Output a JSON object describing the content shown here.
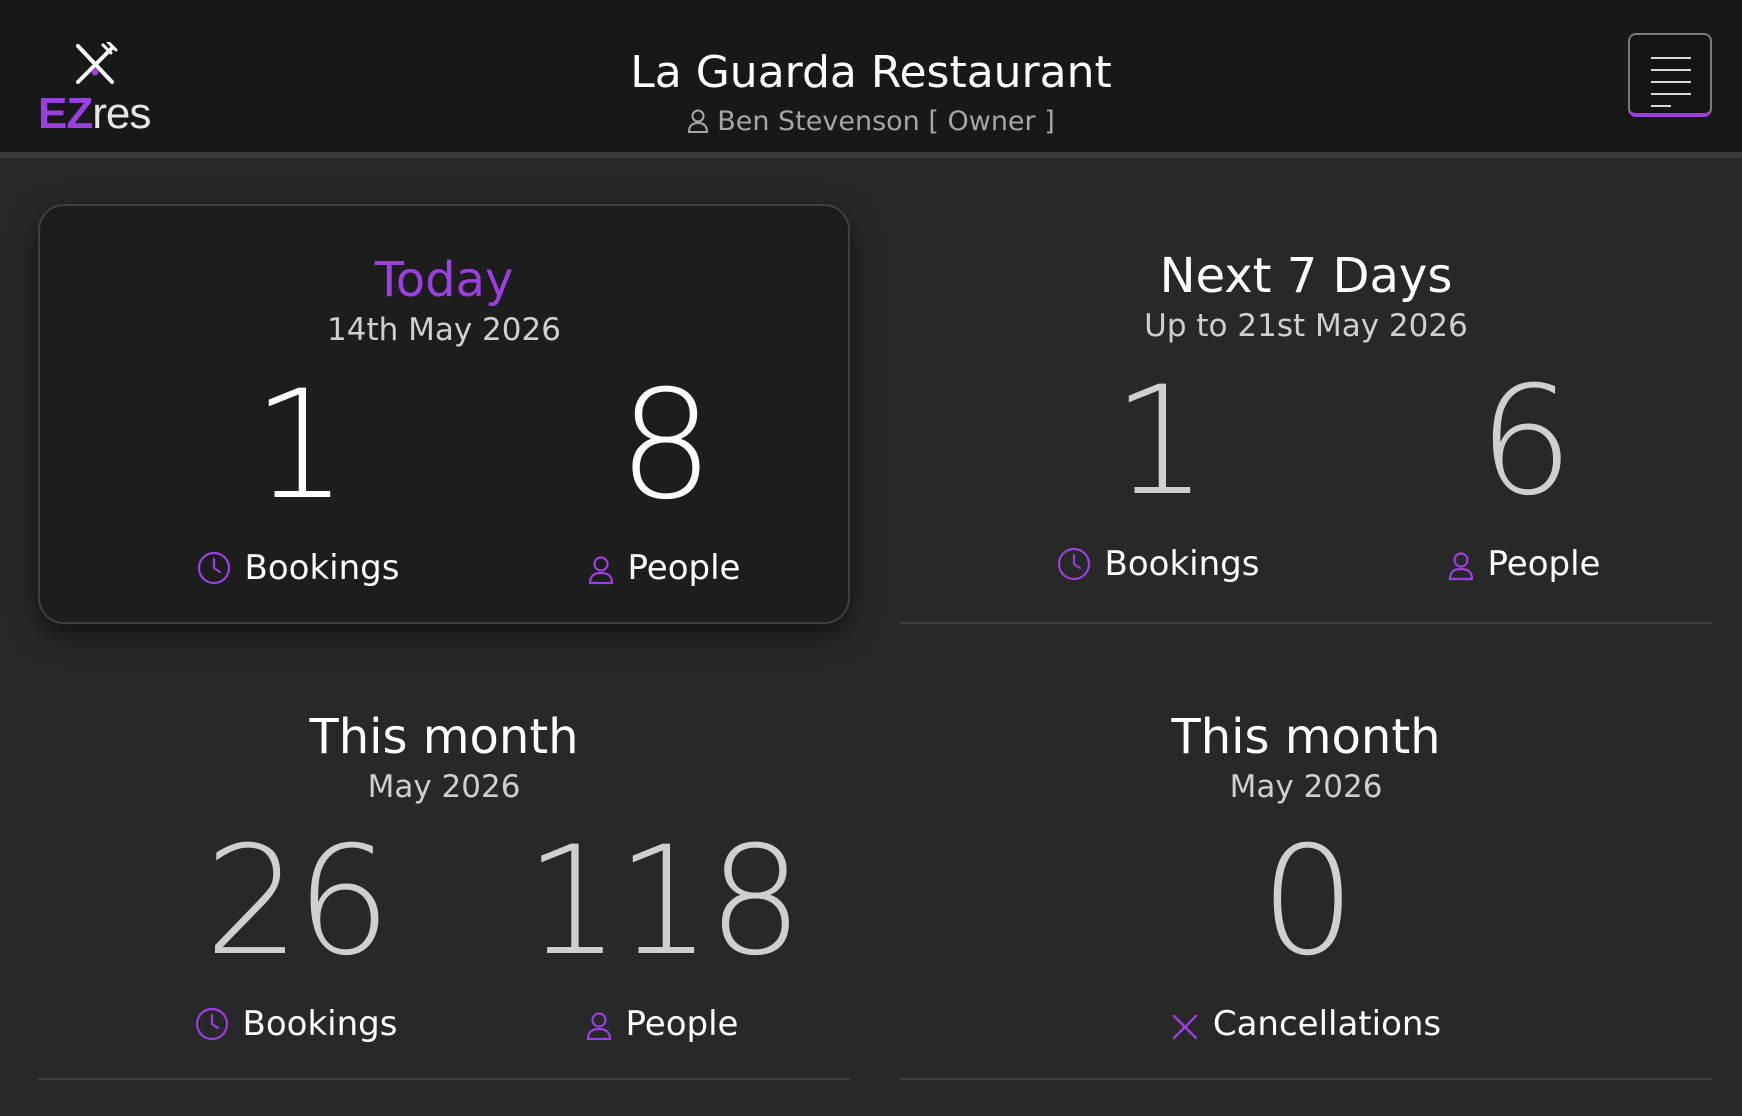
{
  "header": {
    "logo": {
      "prefix": "EZ",
      "suffix": "res"
    },
    "title": "La Guarda Restaurant",
    "user": "Ben Stevenson [ Owner ]"
  },
  "colors": {
    "accent": "#9b3fe0",
    "background": "#282828",
    "header": "#181818",
    "card": "#1d1d1d"
  },
  "cards": {
    "today": {
      "title": "Today",
      "subtitle": "14th May 2026",
      "bookings": {
        "value": "1",
        "label": "Bookings",
        "icon": "clock-icon"
      },
      "people": {
        "value": "8",
        "label": "People",
        "icon": "person-icon"
      }
    },
    "next7": {
      "title": "Next 7 Days",
      "subtitle": "Up to 21st May 2026",
      "bookings": {
        "value": "1",
        "label": "Bookings",
        "icon": "clock-icon"
      },
      "people": {
        "value": "6",
        "label": "People",
        "icon": "person-icon"
      }
    },
    "month": {
      "title": "This month",
      "subtitle": "May 2026",
      "bookings": {
        "value": "26",
        "label": "Bookings",
        "icon": "clock-icon"
      },
      "people": {
        "value": "118",
        "label": "People",
        "icon": "person-icon"
      }
    },
    "cancellations": {
      "title": "This month",
      "subtitle": "May 2026",
      "count": {
        "value": "0",
        "label": "Cancellations",
        "icon": "x-icon"
      }
    }
  }
}
